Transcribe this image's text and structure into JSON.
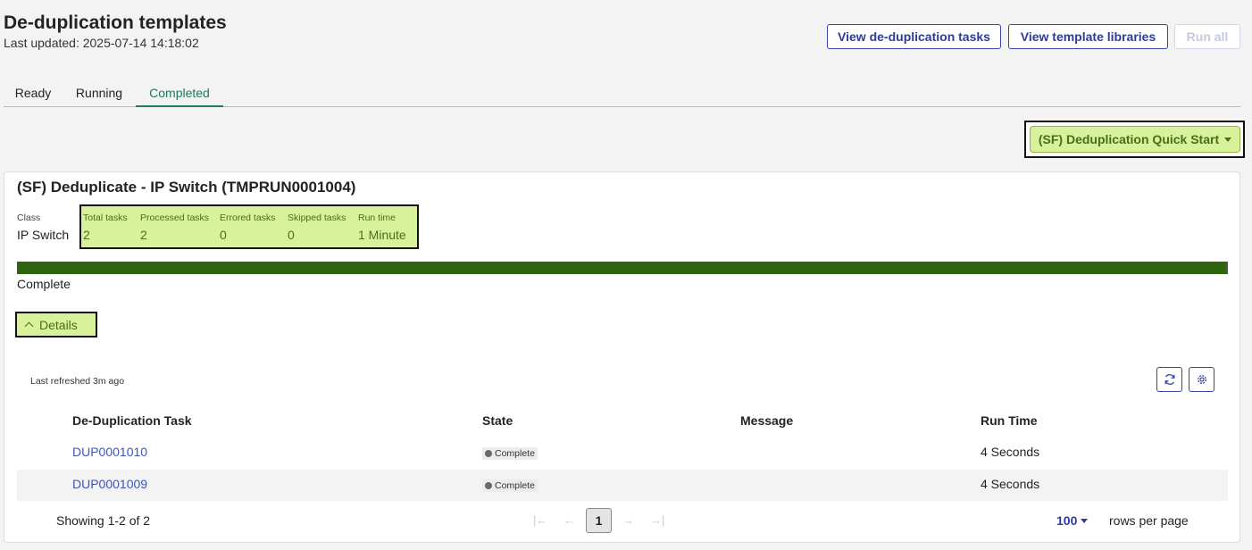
{
  "header": {
    "title": "De-duplication templates",
    "last_updated": "Last updated: 2025-07-14 14:18:02",
    "buttons": {
      "view_tasks": "View de-duplication tasks",
      "view_libraries": "View template libraries",
      "run_all": "Run all"
    }
  },
  "tabs": [
    {
      "label": "Ready"
    },
    {
      "label": "Running"
    },
    {
      "label": "Completed",
      "active": true
    }
  ],
  "quick_start": {
    "label": "(SF) Deduplication Quick Start"
  },
  "card": {
    "title": "(SF) Deduplicate - IP Switch (TMPRUN0001004)",
    "class_label": "Class",
    "class_value": "IP Switch",
    "stats": [
      {
        "label": "Total tasks",
        "value": "2"
      },
      {
        "label": "Processed tasks",
        "value": "2"
      },
      {
        "label": "Errored tasks",
        "value": "0"
      },
      {
        "label": "Skipped tasks",
        "value": "0"
      },
      {
        "label": "Run time",
        "value": "1 Minute"
      }
    ],
    "progress_fraction": 1.0,
    "progress_label": "Complete",
    "details_label": "Details"
  },
  "table": {
    "last_refreshed": "Last refreshed 3m ago",
    "columns": [
      "De-Duplication Task",
      "State",
      "Message",
      "Run Time"
    ],
    "rows": [
      {
        "task": "DUP0001010",
        "state": "Complete",
        "message": "",
        "run_time": "4 Seconds"
      },
      {
        "task": "DUP0001009",
        "state": "Complete",
        "message": "",
        "run_time": "4 Seconds"
      }
    ]
  },
  "pagination": {
    "showing": "Showing 1-2 of 2",
    "current_page": "1",
    "rows_per_page_value": "100",
    "rows_per_page_label": "rows per page"
  },
  "colors": {
    "accent_blue": "#2e3a9c",
    "completed_tab": "#1f7a5c",
    "highlight": "#d8f29b",
    "progress_fill": "#2e6410"
  }
}
